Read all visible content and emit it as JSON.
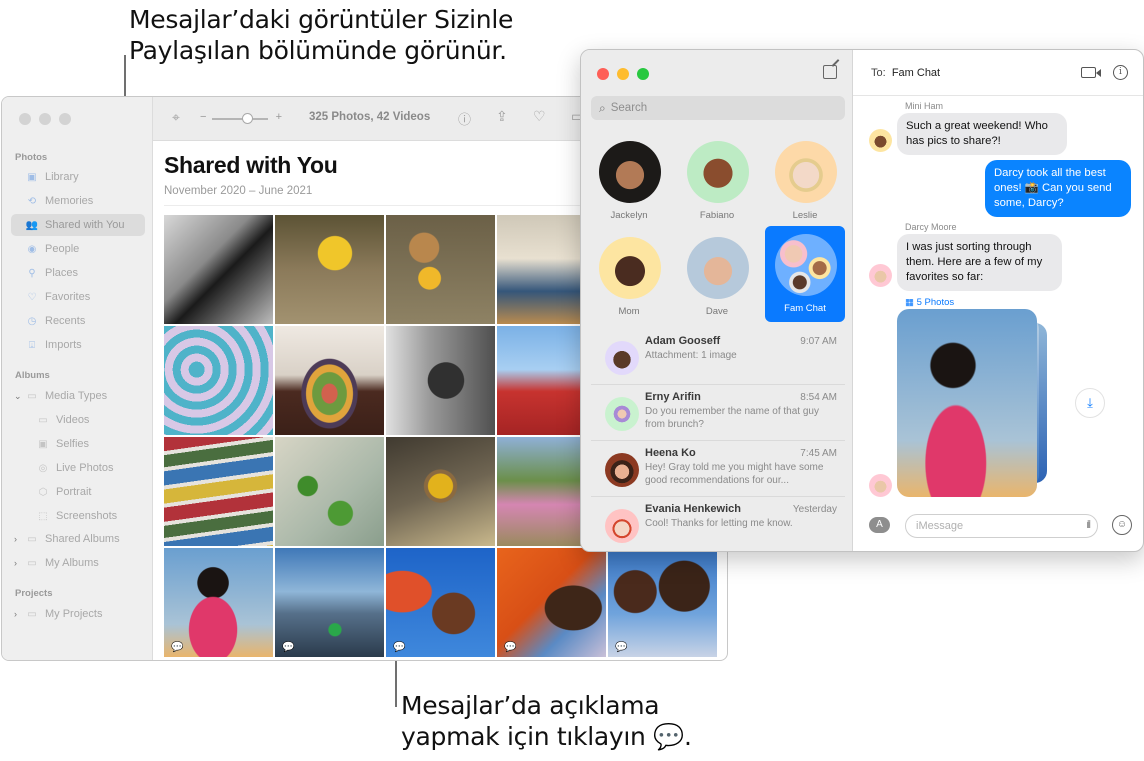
{
  "callouts": {
    "top": "Mesajlar’daki görüntüler Sizinle Paylaşılan bölümünde görünür.",
    "bottom": "Mesajlar’da açıklama yapmak için tıklayın 💬."
  },
  "photos": {
    "sidebar": {
      "sections": {
        "photos": "Photos",
        "albums": "Albums",
        "projects": "Projects"
      },
      "items": [
        {
          "label": "Library",
          "icon": "photo-library-icon"
        },
        {
          "label": "Memories",
          "icon": "memories-icon"
        },
        {
          "label": "Shared with You",
          "icon": "shared-with-you-icon",
          "active": true
        },
        {
          "label": "People",
          "icon": "people-icon"
        },
        {
          "label": "Places",
          "icon": "places-icon"
        },
        {
          "label": "Favorites",
          "icon": "heart-icon"
        },
        {
          "label": "Recents",
          "icon": "clock-icon"
        },
        {
          "label": "Imports",
          "icon": "import-icon"
        }
      ],
      "albums": [
        {
          "label": "Media Types",
          "expanded": true
        },
        {
          "label": "Videos",
          "sub": true
        },
        {
          "label": "Selfies",
          "sub": true
        },
        {
          "label": "Live Photos",
          "sub": true
        },
        {
          "label": "Portrait",
          "sub": true
        },
        {
          "label": "Screenshots",
          "sub": true
        },
        {
          "label": "Shared Albums",
          "expanded": false
        },
        {
          "label": "My Albums",
          "expanded": false
        }
      ],
      "projects": [
        {
          "label": "My Projects",
          "expanded": false
        }
      ]
    },
    "toolbar": {
      "zoom_minus": "−",
      "zoom_plus": "+",
      "count": "325 Photos, 42 Videos"
    },
    "title": "Shared with You",
    "date_range": "November 2020 – June 2021",
    "comment_glyph": "🗨"
  },
  "messages": {
    "search_placeholder": "Search",
    "pinned": [
      {
        "name": "Jackelyn"
      },
      {
        "name": "Fabiano"
      },
      {
        "name": "Leslie"
      },
      {
        "name": "Mom"
      },
      {
        "name": "Dave"
      },
      {
        "name": "Fam Chat",
        "active": true
      }
    ],
    "conversations": [
      {
        "name": "Adam Gooseff",
        "time": "9:07 AM",
        "preview": "Attachment: 1 image"
      },
      {
        "name": "Erny Arifin",
        "time": "8:54 AM",
        "preview": "Do you remember the name of that guy from brunch?"
      },
      {
        "name": "Heena Ko",
        "time": "7:45 AM",
        "preview": "Hey! Gray told me you might have some good recommendations for our..."
      },
      {
        "name": "Evania Henkewich",
        "time": "Yesterday",
        "preview": "Cool! Thanks for letting me know."
      }
    ],
    "chat": {
      "to_label": "To:",
      "to_value": "Fam Chat",
      "messages": [
        {
          "sender": "Mini Ham",
          "text": "Such a great weekend! Who has pics to share?!",
          "direction": "in"
        },
        {
          "text": "Darcy took all the best ones! 📸 Can you send some, Darcy?",
          "direction": "out"
        },
        {
          "sender": "Darcy Moore",
          "text": "I was just sorting through them. Here are a few of my favorites so far:",
          "direction": "in"
        }
      ],
      "photos_link": "5 Photos",
      "input_placeholder": "iMessage"
    }
  }
}
